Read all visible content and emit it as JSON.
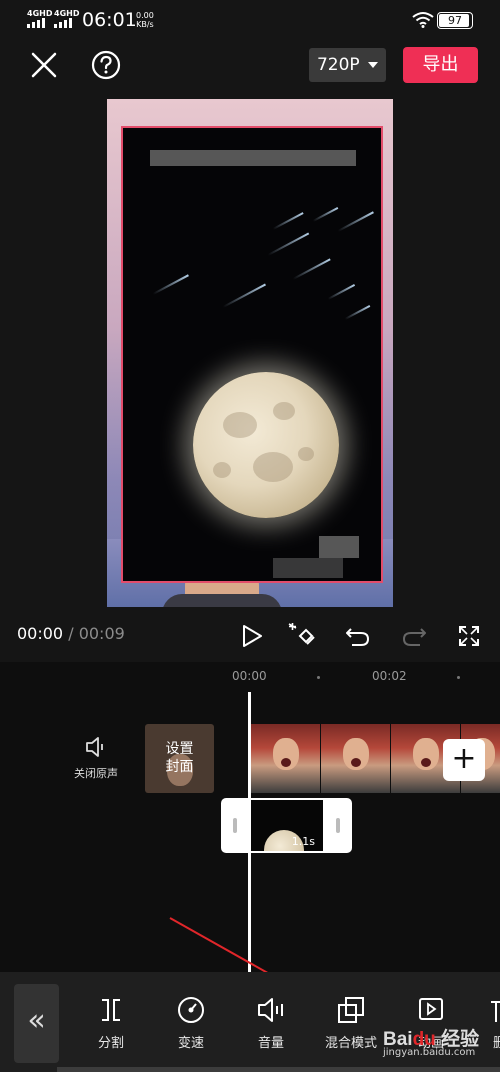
{
  "status_bar": {
    "signal_1": "4GHD",
    "signal_2": "4GHD",
    "time": "06:01",
    "speed_value": "0.00",
    "speed_unit": "KB/s",
    "battery": "97"
  },
  "top_bar": {
    "close_icon": "close-icon",
    "help_icon": "question-circle-icon",
    "resolution": "720P",
    "export_label": "导出"
  },
  "player": {
    "current_time": "00:00",
    "separator": "/",
    "total_time": "00:09"
  },
  "timeline": {
    "tick_start": "00:00",
    "tick_mid": "00:02",
    "mute_label": "关闭原声",
    "cover_label_1": "设置",
    "cover_label_2": "封面",
    "overlay_duration": "1.1s",
    "add_label": "+"
  },
  "toolbar": {
    "back_label": "«",
    "items": [
      {
        "label": "分割",
        "icon": "split-icon"
      },
      {
        "label": "变速",
        "icon": "speed-icon"
      },
      {
        "label": "音量",
        "icon": "volume-icon"
      },
      {
        "label": "混合模式",
        "icon": "blend-mode-icon"
      },
      {
        "label": "动画",
        "icon": "animation-icon"
      },
      {
        "label": "删",
        "icon": "delete-icon"
      }
    ]
  },
  "colors": {
    "accent": "#ef2f55",
    "background": "#151515",
    "toolbar_bg": "#1f1f1f"
  }
}
